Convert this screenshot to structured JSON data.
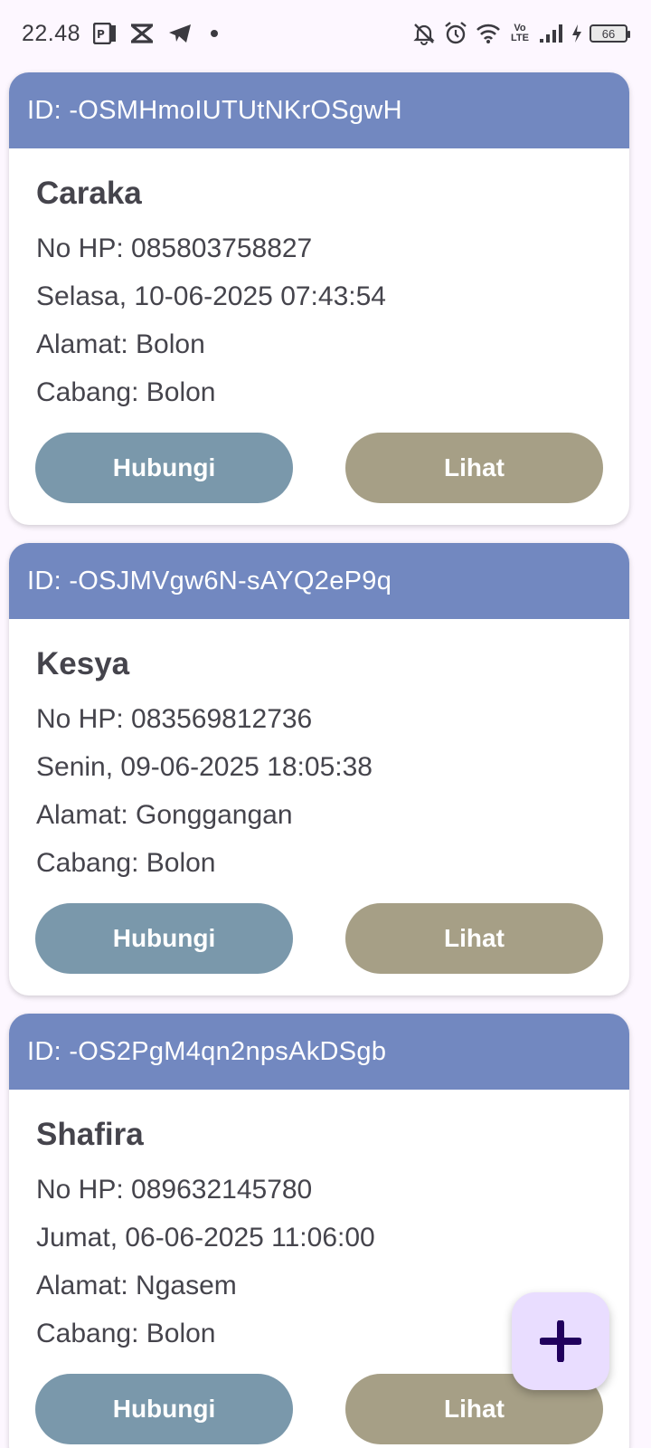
{
  "status_bar": {
    "time": "22.48",
    "battery_level": "66",
    "network": "Vo LTE",
    "icons": [
      "pdf-icon",
      "x-app-icon",
      "telegram-icon",
      "notification-dot-icon",
      "bell-off-icon",
      "alarm-icon",
      "wifi-icon",
      "volte-icon",
      "signal-icon",
      "charging-icon",
      "battery-icon"
    ]
  },
  "cards": [
    {
      "id_label": "ID: -OSMHmoIUTUtNKrOSgwH",
      "name": "Caraka",
      "phone": "No HP: 085803758827",
      "datetime": "Selasa, 10-06-2025 07:43:54",
      "address": "Alamat: Bolon",
      "branch": "Cabang: Bolon",
      "contact_label": "Hubungi",
      "view_label": "Lihat"
    },
    {
      "id_label": "ID: -OSJMVgw6N-sAYQ2eP9q",
      "name": "Kesya",
      "phone": "No HP: 083569812736",
      "datetime": "Senin, 09-06-2025 18:05:38",
      "address": "Alamat: Gonggangan",
      "branch": "Cabang: Bolon",
      "contact_label": "Hubungi",
      "view_label": "Lihat"
    },
    {
      "id_label": "ID: -OS2PgM4qn2npsAkDSgb",
      "name": "Shafira",
      "phone": "No HP: 089632145780",
      "datetime": "Jumat, 06-06-2025 11:06:00",
      "address": "Alamat: Ngasem",
      "branch": "Cabang: Bolon",
      "contact_label": "Hubungi",
      "view_label": "Lihat"
    }
  ],
  "fab": {
    "icon": "plus-icon"
  },
  "colors": {
    "background": "#fdf7ff",
    "card_header": "#7288c0",
    "contact_button": "#7a98ab",
    "view_button": "#a69f86",
    "fab_background": "#e9ddff",
    "fab_icon": "#21005d"
  }
}
